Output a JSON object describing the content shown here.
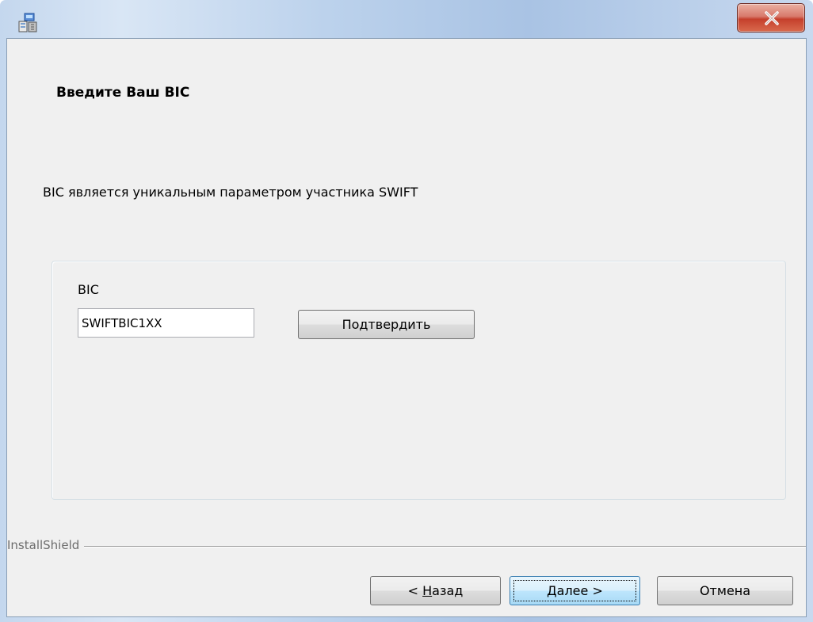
{
  "window": {
    "close_symbol": "X",
    "accent_color": "#c5402c"
  },
  "dialog": {
    "heading": "Введите Ваш BIC",
    "description": "BIC является уникальным параметром участника SWIFT"
  },
  "bic_group": {
    "label": "BIC",
    "input_value": "SWIFTBIC1XX",
    "confirm_label": "Подтвердить"
  },
  "footer": {
    "brand": "InstallShield",
    "back_prefix": "< ",
    "back_mnemonic": "Н",
    "back_rest": "азад",
    "next_mnemonic": "Д",
    "next_rest": "алее >",
    "cancel_label": "Отмена"
  },
  "icons": [
    "installer-icon",
    "close-icon"
  ]
}
